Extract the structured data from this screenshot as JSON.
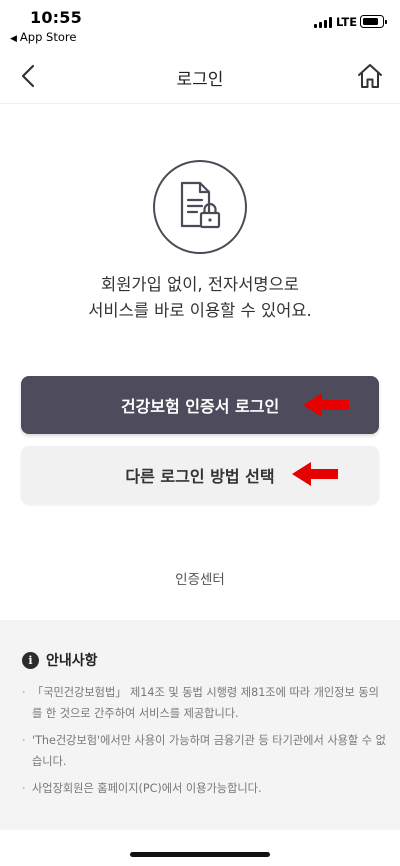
{
  "status_bar": {
    "time": "10:55",
    "back_app": "App Store",
    "network": "LTE"
  },
  "header": {
    "title": "로그인",
    "back_icon": "chevron-left-icon",
    "home_icon": "home-icon"
  },
  "hero": {
    "icon": "document-lock-icon",
    "line1": "회원가입 없이, 전자서명으로",
    "line2": "서비스를 바로 이용할 수 있어요."
  },
  "buttons": {
    "primary_label": "건강보험 인증서 로그인",
    "secondary_label": "다른 로그인 방법 선택"
  },
  "links": {
    "cert_center": "인증센터"
  },
  "notice": {
    "title": "안내사항",
    "items": [
      "「국민건강보험법」 제14조 및 동법 시행령 제81조에 따라 개인정보 동의를 한 것으로 간주하여 서비스를 제공합니다.",
      "'The건강보험'에서만 사용이 가능하며 금융기관 등 타기관에서 사용할 수 없습니다.",
      "사업장회원은 홈페이지(PC)에서 이용가능합니다."
    ]
  },
  "colors": {
    "primary_button": "#4d4b5c",
    "secondary_button": "#f1f1f1",
    "annotation_arrow": "#e60000",
    "notice_bg": "#f4f4f5"
  }
}
